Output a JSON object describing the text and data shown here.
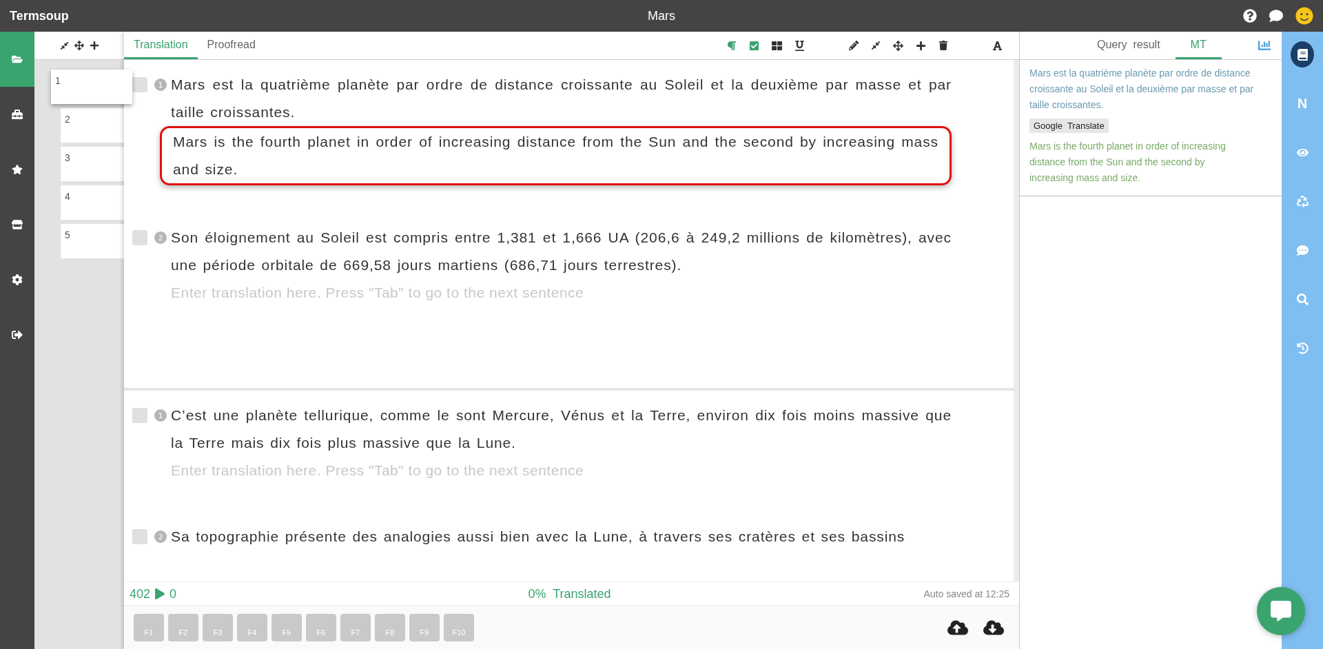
{
  "app": {
    "name": "Termsoup",
    "document_title": "Mars"
  },
  "nav": [
    {
      "selected": true
    },
    {
      "selected": false
    },
    {
      "selected": false
    },
    {
      "selected": false
    },
    {
      "selected": false
    },
    {
      "selected": false
    }
  ],
  "pages": [
    {
      "label": "1",
      "selected": true
    },
    {
      "label": "2",
      "selected": false
    },
    {
      "label": "3",
      "selected": false
    },
    {
      "label": "4",
      "selected": false
    },
    {
      "label": "5",
      "selected": false
    }
  ],
  "editor_tabs": [
    {
      "label": "Translation",
      "selected": true
    },
    {
      "label": "Proofread",
      "selected": false
    }
  ],
  "toolbar_toggles": [
    {
      "on": true
    },
    {
      "on": true
    },
    {
      "on": false
    },
    {
      "on": false
    }
  ],
  "paragraphs": [
    {
      "segments": [
        {
          "number": "1",
          "checked": false,
          "source": "Mars est la quatrième planète par ordre de distance croissante au Soleil et la deuxième par masse et par taille croissantes.",
          "target": "Mars is the fourth planet in order of increasing distance from the Sun and the second by increasing mass and size.",
          "active": true
        },
        {
          "number": "2",
          "checked": false,
          "source": "Son éloignement au Soleil est compris entre 1,381 et 1,666 UA (206,6 à 249,2 millions de kilomètres), avec une période orbitale de 669,58 jours martiens (686,71 jours terrestres).",
          "placeholder": "Enter translation here. Press \"Tab\" to go to the next sentence"
        }
      ]
    },
    {
      "segments": [
        {
          "number": "1",
          "checked": false,
          "source": "C’est une planète tellurique, comme le sont Mercure, Vénus et la Terre, environ dix fois moins massive que la Terre mais dix fois plus massive que la Lune.",
          "placeholder": "Enter translation here. Press \"Tab\" to go to the next sentence"
        },
        {
          "number": "2",
          "checked": false,
          "source": "Sa topographie présente des analogies aussi bien avec la Lune, à travers ses cratères et ses bassins"
        }
      ]
    }
  ],
  "status": {
    "words": "402",
    "count": "0",
    "progress": "0%  Translated",
    "saved": "Auto saved at 12:25"
  },
  "function_keys": [
    "F1",
    "F2",
    "F3",
    "F4",
    "F5",
    "F6",
    "F7",
    "F8",
    "F9",
    "F10"
  ],
  "side_tabs": [
    {
      "label": "Query  result",
      "selected": false
    },
    {
      "label": "MT",
      "selected": true
    }
  ],
  "mt": {
    "source": "Mars est la quatrième planète par ordre de distance croissante au Soleil et la deuxième par masse et par taille croissantes.",
    "engine": "Google  Translate",
    "result": "Mars is the fourth planet in order of increasing distance from the Sun and the second by increasing mass and size."
  },
  "right_bar": [
    {
      "kind": "book",
      "selected": true
    },
    {
      "kind": "letter",
      "label": "N",
      "selected": false
    },
    {
      "kind": "eye",
      "selected": false
    },
    {
      "kind": "recycle",
      "selected": false
    },
    {
      "kind": "comment",
      "selected": false
    },
    {
      "kind": "search",
      "selected": false
    },
    {
      "kind": "history",
      "selected": false
    }
  ]
}
